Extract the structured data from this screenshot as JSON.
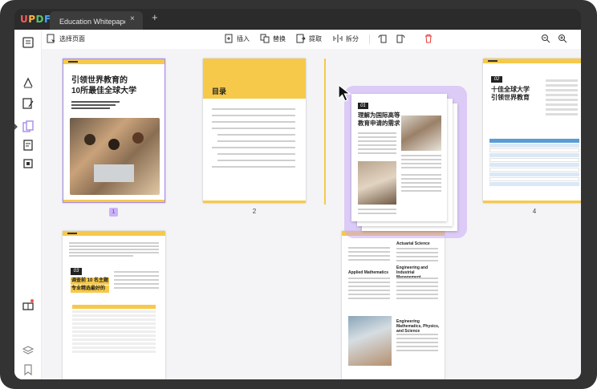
{
  "app": {
    "logo": "UPDF",
    "logo_colors": [
      "#ff5a5a",
      "#ffb23f",
      "#59c46a",
      "#4aa3ff"
    ]
  },
  "tab": {
    "title": "Education Whitepaper-中文",
    "close": "×",
    "add": "+"
  },
  "toolbar": {
    "select_pages": "选择页面",
    "insert": "插入",
    "replace": "替换",
    "extract": "提取",
    "split": "拆分"
  },
  "pages": [
    {
      "number": "1",
      "title_line1": "引领世界教育的",
      "title_line2": "10所最佳全球大学"
    },
    {
      "number": "2",
      "heading": "目录"
    },
    {
      "number": "4",
      "badge": "02",
      "title_line1": "十佳全球大学",
      "title_line2": "引领世界教育"
    }
  ],
  "dragged_page": {
    "badge": "01",
    "title_line1": "理解为国际高等",
    "title_line2": "教育申请的需求"
  },
  "bottom_pages": {
    "left_badge": "03",
    "left_title_line1": "调查前 10 名主题",
    "left_title_line2": "专业精选最好的",
    "right_headings": [
      "Applied Mathematics",
      "Actuarial Science",
      "Engineering and Industrial Management",
      "Engineering Mathematics, Physics, and Science"
    ]
  },
  "colors": {
    "accent": "#f6c94a",
    "selection": "#a98be8",
    "app_bg": "#2b2b2c"
  }
}
